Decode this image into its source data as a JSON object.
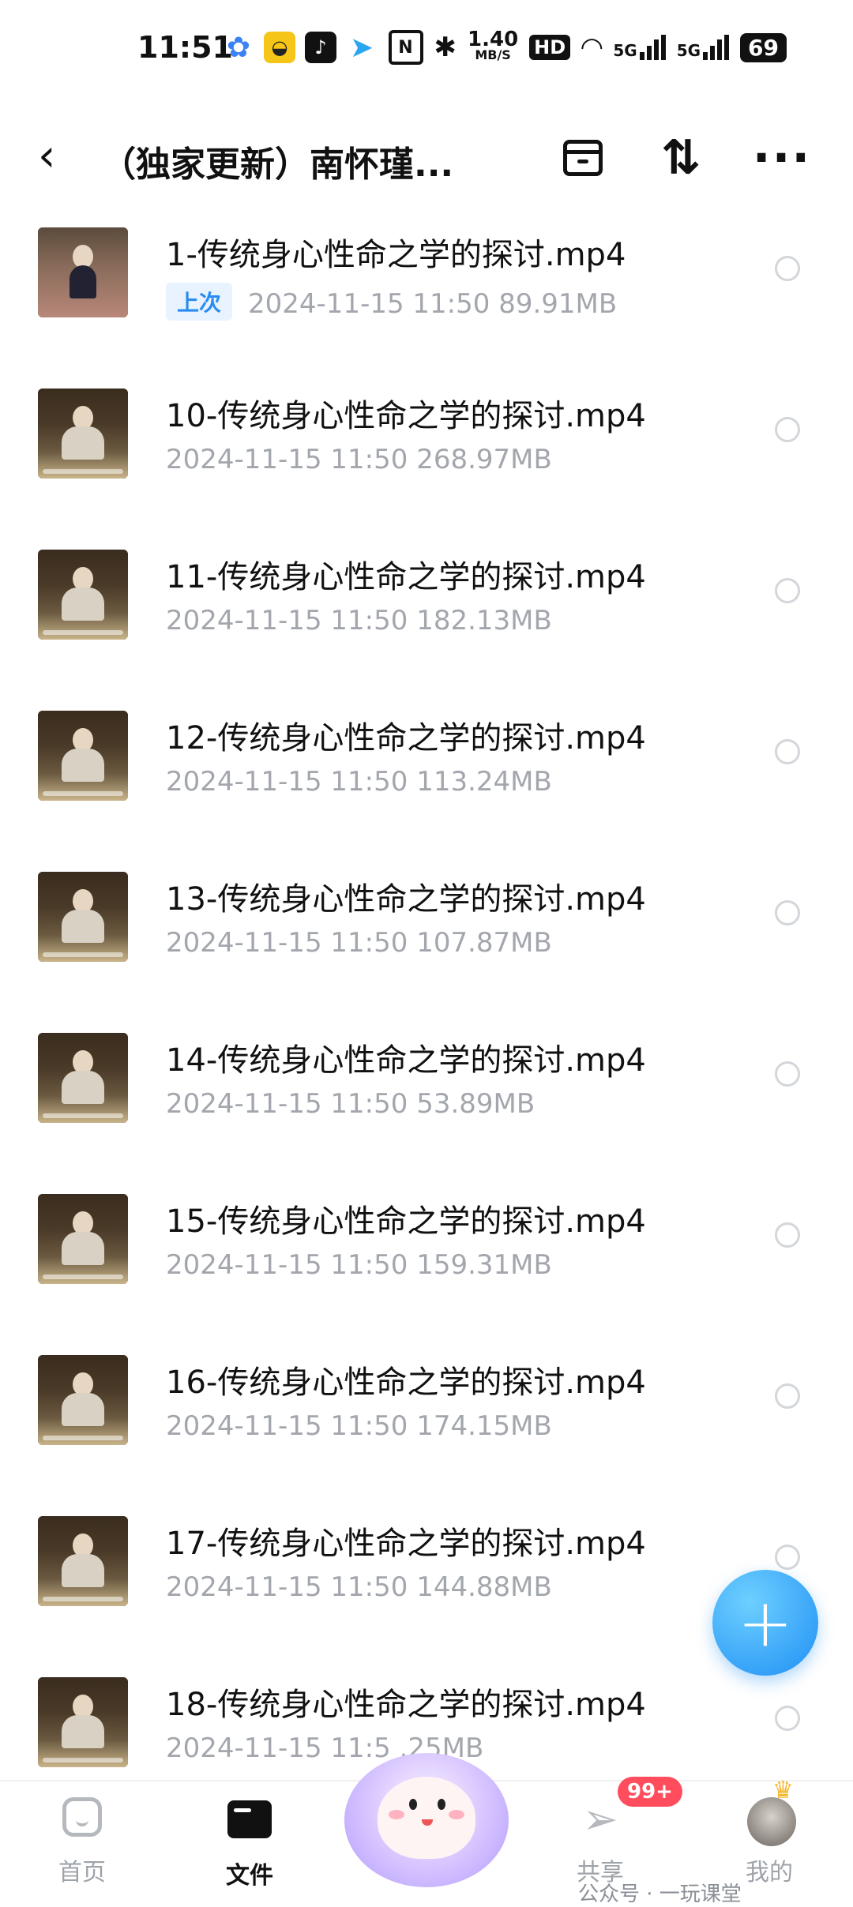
{
  "status_bar": {
    "time": "11:51",
    "speed_value": "1.40",
    "speed_unit": "MB/S",
    "hd": "HD",
    "sig1": "5G",
    "sig2": "5G",
    "battery": "69"
  },
  "header": {
    "back_icon": "chevron-left-icon",
    "title": "（独家更新）南怀瑾..."
  },
  "files": [
    {
      "name": "1-传统身心性命之学的探讨.mp4",
      "tag": "上次",
      "date": "2024-11-15",
      "time": "11:50",
      "size": "89.91MB"
    },
    {
      "name": "10-传统身心性命之学的探讨.mp4",
      "date": "2024-11-15",
      "time": "11:50",
      "size": "268.97MB"
    },
    {
      "name": "11-传统身心性命之学的探讨.mp4",
      "date": "2024-11-15",
      "time": "11:50",
      "size": "182.13MB"
    },
    {
      "name": "12-传统身心性命之学的探讨.mp4",
      "date": "2024-11-15",
      "time": "11:50",
      "size": "113.24MB"
    },
    {
      "name": "13-传统身心性命之学的探讨.mp4",
      "date": "2024-11-15",
      "time": "11:50",
      "size": "107.87MB"
    },
    {
      "name": "14-传统身心性命之学的探讨.mp4",
      "date": "2024-11-15",
      "time": "11:50",
      "size": "53.89MB"
    },
    {
      "name": "15-传统身心性命之学的探讨.mp4",
      "date": "2024-11-15",
      "time": "11:50",
      "size": "159.31MB"
    },
    {
      "name": "16-传统身心性命之学的探讨.mp4",
      "date": "2024-11-15",
      "time": "11:50",
      "size": "174.15MB"
    },
    {
      "name": "17-传统身心性命之学的探讨.mp4",
      "date": "2024-11-15",
      "time": "11:50",
      "size": "144.88MB"
    },
    {
      "name": "18-传统身心性命之学的探讨.mp4",
      "date": "2024-11-15",
      "time": "11:5",
      "size": ".25MB"
    }
  ],
  "fab": {
    "label": "+"
  },
  "nav": {
    "home": "首页",
    "files": "文件",
    "share": "共享",
    "share_badge": "99+",
    "me": "我的"
  },
  "watermark": "公众号 · 一玩课堂"
}
